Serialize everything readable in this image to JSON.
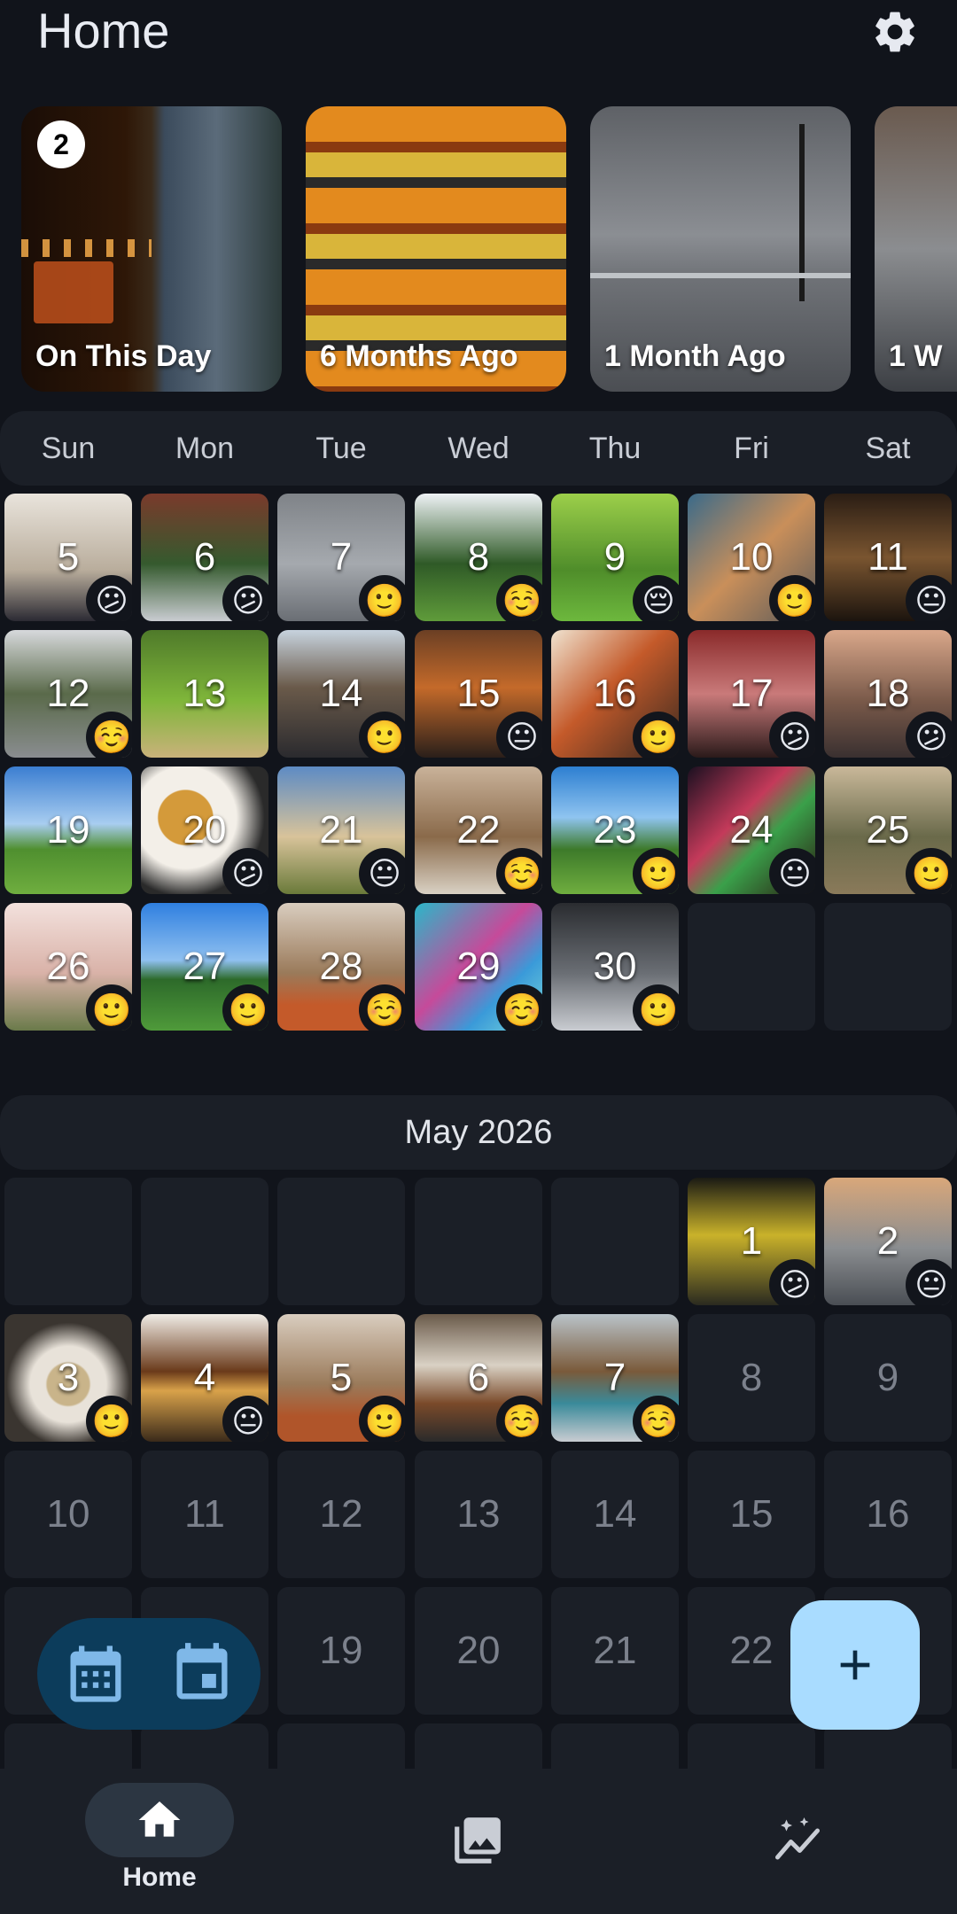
{
  "header": {
    "title": "Home"
  },
  "memories": [
    {
      "label": "On This Day",
      "badge": "2"
    },
    {
      "label": "6 Months Ago"
    },
    {
      "label": "1 Month Ago"
    },
    {
      "label": "1 W"
    }
  ],
  "weekdays": [
    "Sun",
    "Mon",
    "Tue",
    "Wed",
    "Thu",
    "Fri",
    "Sat"
  ],
  "april_days": [
    "5",
    "6",
    "7",
    "8",
    "9",
    "10",
    "11",
    "12",
    "13",
    "14",
    "15",
    "16",
    "17",
    "18",
    "19",
    "20",
    "21",
    "22",
    "23",
    "24",
    "25",
    "26",
    "27",
    "28",
    "29",
    "30"
  ],
  "may": {
    "label": "May 2026",
    "days": [
      "1",
      "2",
      "3",
      "4",
      "5",
      "6",
      "7",
      "8",
      "9",
      "10",
      "11",
      "12",
      "13",
      "14",
      "15",
      "16",
      "19",
      "20",
      "21",
      "22"
    ]
  },
  "nav": {
    "home_label": "Home"
  },
  "colors": {
    "background": "#11141b",
    "surface": "#1b1f27",
    "fab": "#a9dcff",
    "toggle": "#0c3c5b",
    "nav_pill": "#2c3642"
  }
}
